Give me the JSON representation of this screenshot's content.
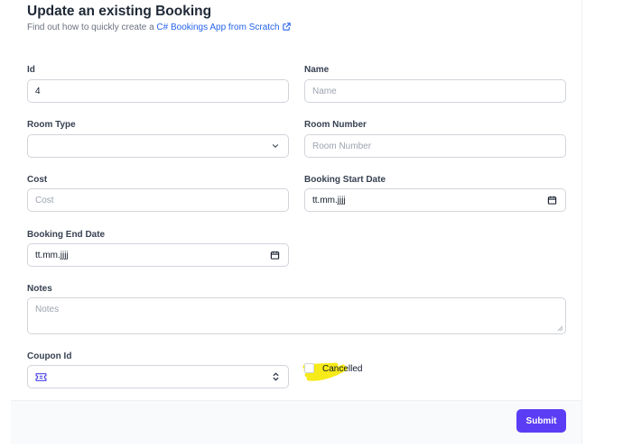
{
  "header": {
    "title": "Update an existing Booking",
    "subtitle_prefix": "Find out how to quickly create a ",
    "subtitle_link": "C# Bookings App from Scratch",
    "link_icon": "external-link-icon"
  },
  "form": {
    "id": {
      "label": "Id",
      "value": "4"
    },
    "name": {
      "label": "Name",
      "placeholder": "Name"
    },
    "room_type": {
      "label": "Room Type",
      "value": "",
      "icon": "chevron-down-icon"
    },
    "room_number": {
      "label": "Room Number",
      "placeholder": "Room Number"
    },
    "cost": {
      "label": "Cost",
      "placeholder": "Cost"
    },
    "booking_start_date": {
      "label": "Booking Start Date",
      "value": "tt.mm.jjjj",
      "icon": "calendar-icon"
    },
    "booking_end_date": {
      "label": "Booking End Date",
      "value": "tt.mm.jjjj",
      "icon": "calendar-icon"
    },
    "notes": {
      "label": "Notes",
      "placeholder": "Notes"
    },
    "coupon_id": {
      "label": "Coupon Id",
      "icon": "ticket-icon",
      "trail_icon": "chevron-up-down-icon"
    },
    "cancelled": {
      "label": "Cancelled",
      "checked": false
    }
  },
  "footer": {
    "submit_label": "Submit"
  },
  "colors": {
    "accent": "#5b3df5",
    "link": "#2563eb",
    "highlight": "#f5e90c"
  }
}
